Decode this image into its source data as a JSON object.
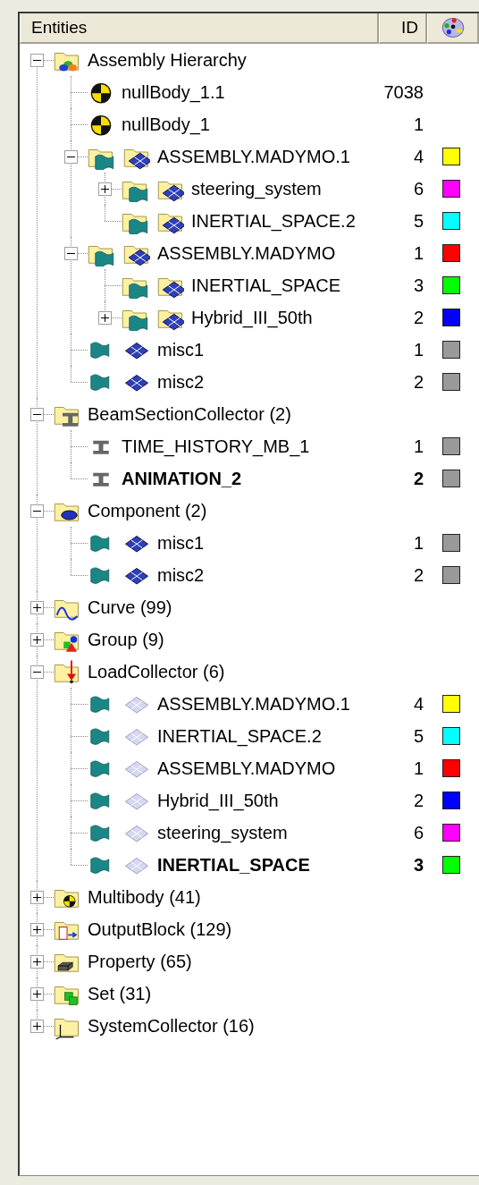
{
  "header": {
    "columns": [
      "Entities",
      "ID"
    ]
  },
  "tree": [
    {
      "label": "Assembly Hierarchy",
      "kind": "hierarchy",
      "expanded": true,
      "active": false,
      "children": [
        {
          "label": "nullBody_1.1",
          "kind": "body",
          "id": "7038",
          "active": false
        },
        {
          "label": "nullBody_1",
          "kind": "body",
          "id": "1",
          "active": false
        },
        {
          "label": "ASSEMBLY.MADYMO.1",
          "kind": "assembly",
          "id": "4",
          "color": "#ffff00",
          "expanded": true,
          "active": false,
          "children": [
            {
              "label": "steering_system",
              "kind": "assembly",
              "id": "6",
              "color": "#ff00ff",
              "expanded": false,
              "active": false
            },
            {
              "label": "INERTIAL_SPACE.2",
              "kind": "assembly",
              "id": "5",
              "color": "#00ffff",
              "active": false
            }
          ]
        },
        {
          "label": "ASSEMBLY.MADYMO",
          "kind": "assembly",
          "id": "1",
          "color": "#ff0000",
          "expanded": true,
          "active": false,
          "children": [
            {
              "label": "INERTIAL_SPACE",
              "kind": "assembly",
              "id": "3",
              "color": "#00ff00",
              "active": false
            },
            {
              "label": "Hybrid_III_50th",
              "kind": "assembly",
              "id": "2",
              "color": "#0000ff",
              "expanded": false,
              "active": false
            }
          ]
        },
        {
          "label": "misc1",
          "kind": "part",
          "id": "1",
          "color": "#999999",
          "active": false
        },
        {
          "label": "misc2",
          "kind": "part",
          "id": "2",
          "color": "#999999",
          "active": false
        }
      ]
    },
    {
      "label": "BeamSectionCollector (2)",
      "kind": "beams",
      "expanded": true,
      "active": false,
      "children": [
        {
          "label": "TIME_HISTORY_MB_1",
          "kind": "beam",
          "id": "1",
          "color": "#999999",
          "active": false
        },
        {
          "label": "ANIMATION_2",
          "kind": "beam",
          "id": "2",
          "color": "#999999",
          "active": true
        }
      ]
    },
    {
      "label": "Component (2)",
      "kind": "component",
      "expanded": true,
      "active": false,
      "children": [
        {
          "label": "misc1",
          "kind": "part",
          "id": "1",
          "color": "#999999",
          "active": false
        },
        {
          "label": "misc2",
          "kind": "part",
          "id": "2",
          "color": "#999999",
          "active": false
        }
      ]
    },
    {
      "label": "Curve (99)",
      "kind": "curve",
      "expanded": false,
      "active": false
    },
    {
      "label": "Group (9)",
      "kind": "group",
      "expanded": false,
      "active": false
    },
    {
      "label": "LoadCollector (6)",
      "kind": "load",
      "expanded": true,
      "active": false,
      "children": [
        {
          "label": "ASSEMBLY.MADYMO.1",
          "kind": "ghostpart",
          "id": "4",
          "color": "#ffff00",
          "active": false
        },
        {
          "label": "INERTIAL_SPACE.2",
          "kind": "ghostpart",
          "id": "5",
          "color": "#00ffff",
          "active": false
        },
        {
          "label": "ASSEMBLY.MADYMO",
          "kind": "ghostpart",
          "id": "1",
          "color": "#ff0000",
          "active": false
        },
        {
          "label": "Hybrid_III_50th",
          "kind": "ghostpart",
          "id": "2",
          "color": "#0000ff",
          "active": false
        },
        {
          "label": "steering_system",
          "kind": "ghostpart",
          "id": "6",
          "color": "#ff00ff",
          "active": false
        },
        {
          "label": "INERTIAL_SPACE",
          "kind": "ghostpart",
          "id": "3",
          "color": "#00ff00",
          "active": true
        }
      ]
    },
    {
      "label": "Multibody (41)",
      "kind": "multibody",
      "expanded": false,
      "active": false
    },
    {
      "label": "OutputBlock (129)",
      "kind": "output",
      "expanded": false,
      "active": false
    },
    {
      "label": "Property (65)",
      "kind": "property",
      "expanded": false,
      "active": false
    },
    {
      "label": "Set (31)",
      "kind": "set",
      "expanded": false,
      "active": false
    },
    {
      "label": "SystemCollector (16)",
      "kind": "system",
      "expanded": false,
      "active": false
    }
  ]
}
